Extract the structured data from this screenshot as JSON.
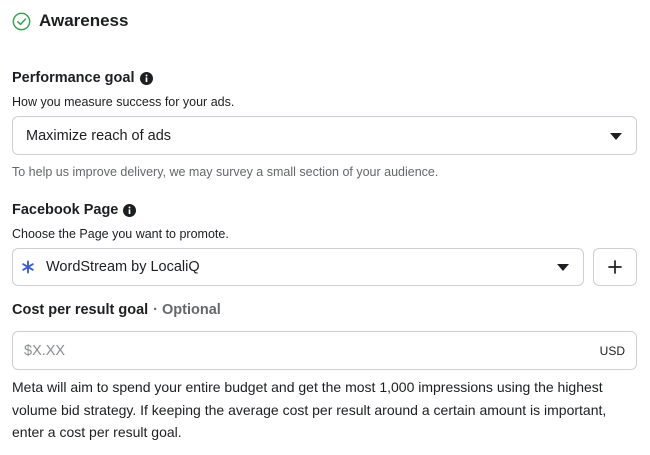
{
  "section": {
    "title": "Awareness",
    "check_icon": "circle-check-icon",
    "accent_color": "#31a24c"
  },
  "performance_goal": {
    "label": "Performance goal",
    "info_icon": "info-icon",
    "helper": "How you measure success for your ads.",
    "selected": "Maximize reach of ads",
    "note": "To help us improve delivery, we may survey a small section of your audience."
  },
  "facebook_page": {
    "label": "Facebook Page",
    "info_icon": "info-icon",
    "helper": "Choose the Page you want to promote.",
    "selected": "WordStream by LocaliQ",
    "page_icon": "asterisk-icon",
    "page_icon_color": "#3b5cd9",
    "add_icon": "plus-icon"
  },
  "cost_goal": {
    "label": "Cost per result goal",
    "optional": "· Optional",
    "placeholder": "$X.XX",
    "currency": "USD",
    "description": "Meta will aim to spend your entire budget and get the most 1,000 impressions using the highest volume bid strategy. If keeping the average cost per result around a certain amount is important, enter a cost per result goal."
  }
}
